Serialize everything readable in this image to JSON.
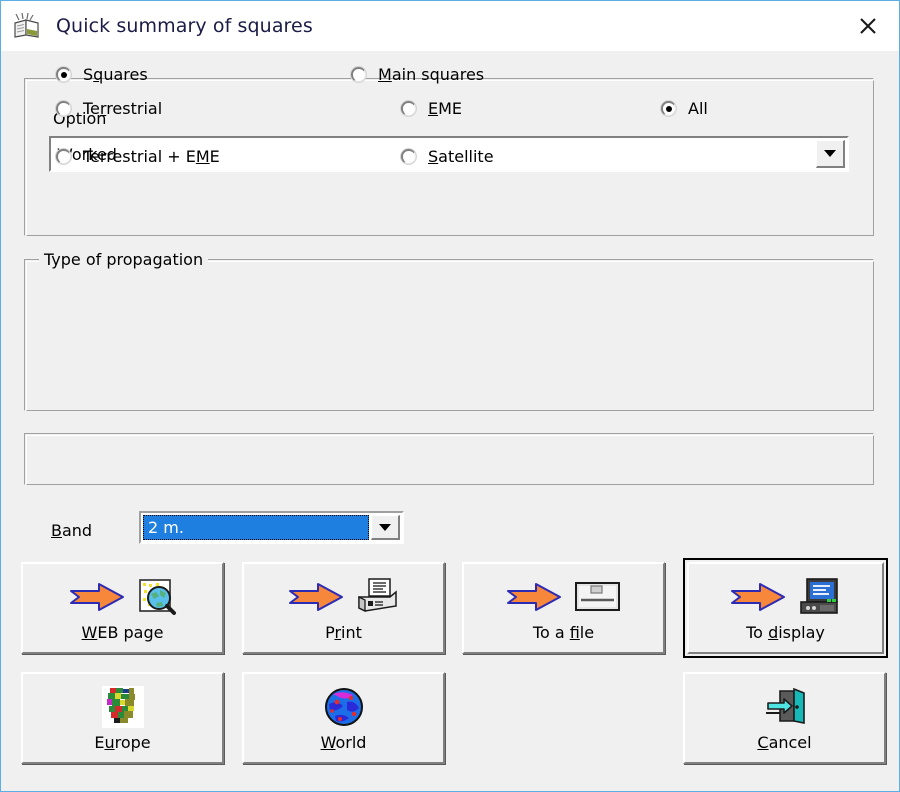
{
  "window": {
    "title": "Quick summary of squares",
    "title_icon": "book-antenna-icon",
    "close_label": "✕",
    "accent_border": "#5daee6",
    "face_color": "#f0f0f0",
    "highlight_color": "#1f7fe0"
  },
  "option": {
    "label": "Option",
    "value": "Worked",
    "arrow_icon": "chevron-down-icon"
  },
  "propagation": {
    "legend": "Type of propagation",
    "options": [
      {
        "label": "Terrestrial",
        "mnemonic": "r",
        "pre": "Te",
        "post": "restrial",
        "checked": false
      },
      {
        "label": "Terrestrial + EME",
        "mnemonic": "M",
        "pre": "Terrestrial + E",
        "post": "E",
        "checked": false
      },
      {
        "label": "EME",
        "mnemonic": "E",
        "pre": "",
        "post": "ME",
        "checked": false
      },
      {
        "label": "Satellite",
        "mnemonic": "S",
        "pre": "",
        "post": "atellite",
        "checked": false
      },
      {
        "label": "All",
        "mnemonic": "",
        "pre": "All",
        "post": "",
        "checked": true
      }
    ]
  },
  "squares": {
    "options": [
      {
        "label": "Squares",
        "mnemonic": "q",
        "pre": "S",
        "post": "uares",
        "checked": true
      },
      {
        "label": "Main squares",
        "mnemonic": "M",
        "pre": "",
        "post": "ain squares",
        "checked": false
      }
    ]
  },
  "band": {
    "label": "Band",
    "label_pre": "",
    "label_mnemonic": "B",
    "label_post": "and",
    "value": "2 m.",
    "arrow_icon": "chevron-down-icon"
  },
  "buttons": [
    {
      "name": "web-page",
      "caption": "WEB page",
      "pre": "",
      "mnemonic": "W",
      "post": "EB page",
      "icons": [
        "orange-arrow-icon",
        "web-page-globe-icon"
      ],
      "default": false
    },
    {
      "name": "print",
      "caption": "Print",
      "pre": "P",
      "mnemonic": "r",
      "post": "int",
      "icons": [
        "orange-arrow-icon",
        "printer-icon"
      ],
      "default": false
    },
    {
      "name": "to-a-file",
      "caption": "To a file",
      "pre": "To a ",
      "mnemonic": "f",
      "post": "ile",
      "icons": [
        "orange-arrow-icon",
        "disk-drive-icon"
      ],
      "default": false
    },
    {
      "name": "to-display",
      "caption": "To display",
      "pre": "To ",
      "mnemonic": "d",
      "post": "isplay",
      "icons": [
        "orange-arrow-icon",
        "computer-monitor-icon"
      ],
      "default": true
    },
    {
      "name": "europe",
      "caption": "Europe",
      "pre": "E",
      "mnemonic": "u",
      "post": "rope",
      "icons": [
        "europe-map-icon"
      ],
      "default": false
    },
    {
      "name": "world",
      "caption": "World",
      "pre": "",
      "mnemonic": "W",
      "post": "orld",
      "icons": [
        "world-globe-icon"
      ],
      "default": false
    },
    {
      "name": "cancel",
      "caption": "Cancel",
      "pre": "",
      "mnemonic": "C",
      "post": "ancel",
      "icons": [
        "exit-door-icon"
      ],
      "default": false
    }
  ]
}
